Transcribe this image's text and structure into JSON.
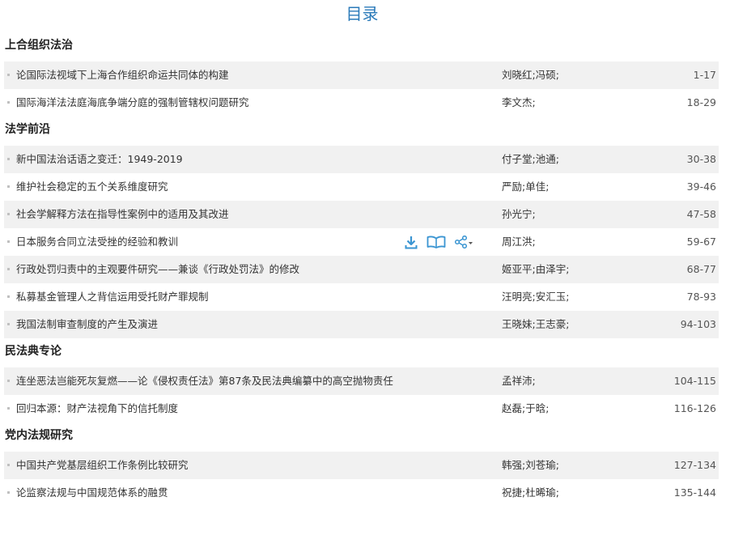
{
  "page": {
    "title": "目录"
  },
  "sections": [
    {
      "title": "上合组织法治",
      "articles": [
        {
          "title": "论国际法视域下上海合作组织命运共同体的构建",
          "authors": "刘晓红;冯硕;",
          "pages": "1-17"
        },
        {
          "title": "国际海洋法法庭海底争端分庭的强制管辖权问题研究",
          "authors": "李文杰;",
          "pages": "18-29"
        }
      ]
    },
    {
      "title": "法学前沿",
      "articles": [
        {
          "title": "新中国法治话语之变迁：1949-2019",
          "authors": "付子堂;池通;",
          "pages": "30-38"
        },
        {
          "title": "维护社会稳定的五个关系维度研究",
          "authors": "严励;单佳;",
          "pages": "39-46"
        },
        {
          "title": "社会学解释方法在指导性案例中的适用及其改进",
          "authors": "孙光宁;",
          "pages": "47-58"
        },
        {
          "title": "日本服务合同立法受挫的经验和教训",
          "authors": "周江洪;",
          "pages": "59-67"
        },
        {
          "title": "行政处罚归责中的主观要件研究——兼谈《行政处罚法》的修改",
          "authors": "姬亚平;由泽宇;",
          "pages": "68-77"
        },
        {
          "title": "私募基金管理人之背信运用受托财产罪规制",
          "authors": "汪明亮;安汇玉;",
          "pages": "78-93"
        },
        {
          "title": "我国法制审查制度的产生及演进",
          "authors": "王晓妹;王志豪;",
          "pages": "94-103"
        }
      ]
    },
    {
      "title": "民法典专论",
      "articles": [
        {
          "title": "连坐恶法岂能死灰复燃——论《侵权责任法》第87条及民法典编纂中的高空抛物责任",
          "authors": "孟祥沛;",
          "pages": "104-115"
        },
        {
          "title": "回归本源：财产法视角下的信托制度",
          "authors": "赵磊;于晗;",
          "pages": "116-126"
        }
      ]
    },
    {
      "title": "党内法规研究",
      "articles": [
        {
          "title": "中国共产党基层组织工作条例比较研究",
          "authors": "韩强;刘苍瑜;",
          "pages": "127-134"
        },
        {
          "title": "论监察法规与中国规范体系的融贯",
          "authors": "祝捷;杜晞瑜;",
          "pages": "135-144"
        }
      ]
    }
  ],
  "hover_tools": {
    "section_index": 1,
    "article_index": 3,
    "icons": [
      "download-icon",
      "read-online-icon",
      "share-icon"
    ]
  },
  "colors": {
    "title_blue": "#2a7ab9",
    "icon_blue": "#3a95d2",
    "row_stripe": "#f1f1f1",
    "bullet": "#c0c0c0"
  }
}
